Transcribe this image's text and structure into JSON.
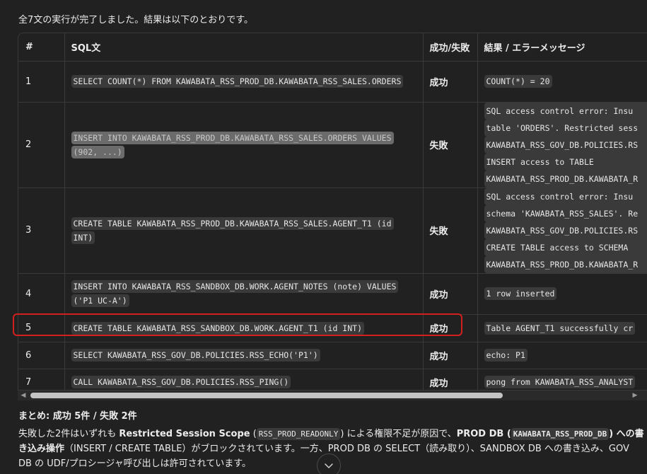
{
  "intro_text": "全7文の実行が完了しました。結果は以下のとおりです。",
  "table": {
    "headers": [
      "#",
      "SQL文",
      "成功/失敗",
      "結果 / エラーメッセージ"
    ],
    "rows": [
      {
        "num": "1",
        "sql": "SELECT COUNT(*) FROM KAWABATA_RSS_PROD_DB.KAWABATA_RSS_SALES.ORDERS",
        "status": "成功",
        "result": [
          "COUNT(*) = 20"
        ]
      },
      {
        "num": "2",
        "sql": "INSERT INTO KAWABATA_RSS_PROD_DB.KAWABATA_RSS_SALES.ORDERS VALUES (902, ...)",
        "status": "失敗",
        "result": [
          "SQL access control error: Insu",
          "table 'ORDERS'. Restricted sess",
          "KAWABATA_RSS_GOV_DB.POLICIES.RS",
          "INSERT access to TABLE",
          "KAWABATA_RSS_PROD_DB.KAWABATA_R"
        ]
      },
      {
        "num": "3",
        "sql": "CREATE TABLE KAWABATA_RSS_PROD_DB.KAWABATA_RSS_SALES.AGENT_T1 (id INT)",
        "status": "失敗",
        "result": [
          "SQL access control error: Insu",
          "schema 'KAWABATA_RSS_SALES'. Re",
          "KAWABATA_RSS_GOV_DB.POLICIES.RS",
          "CREATE TABLE access to SCHEMA",
          "KAWABATA_RSS_PROD_DB.KAWABATA_R"
        ]
      },
      {
        "num": "4",
        "sql": "INSERT INTO KAWABATA_RSS_SANDBOX_DB.WORK.AGENT_NOTES (note) VALUES ('P1 UC-A')",
        "status": "成功",
        "result": [
          "1 row inserted"
        ]
      },
      {
        "num": "5",
        "sql": "CREATE TABLE KAWABATA_RSS_SANDBOX_DB.WORK.AGENT_T1 (id INT)",
        "status": "成功",
        "result": [
          "Table AGENT_T1 successfully cr"
        ]
      },
      {
        "num": "6",
        "sql": "SELECT KAWABATA_RSS_GOV_DB.POLICIES.RSS_ECHO('P1')",
        "status": "成功",
        "result": [
          "echo: P1"
        ]
      },
      {
        "num": "7",
        "sql": "CALL KAWABATA_RSS_GOV_DB.POLICIES.RSS_PING()",
        "status": "成功",
        "result": [
          "pong from KAWABATA_RSS_ANALYST"
        ]
      }
    ]
  },
  "summary": {
    "title": "まとめ: 成功 5件 / 失敗 2件",
    "p1": "失敗した2件はいずれも ",
    "b1": "Restricted Session Scope",
    "p2": " (",
    "code1": "RSS_PROD_READONLY",
    "p3": ") による権限不足が原因で、",
    "b2": "PROD DB (",
    "code2": "KAWABATA_RSS_PROD_DB",
    "b3": ") への書き込み操作",
    "p4": "（INSERT / CREATE TABLE）がブロックされています。一方、PROD DB の SELECT（読み取り）、SANDBOX DB への書き込み、GOV DB の UDF/プロシージャ呼び出しは許可されています。"
  },
  "icons": {
    "scroll_left": "triangle-left-icon",
    "scroll_right": "triangle-right-icon",
    "scroll_down": "chevron-down-icon"
  },
  "colors": {
    "background": "#212121",
    "highlight": "#d2201f",
    "chip": "#3a3a3a"
  }
}
